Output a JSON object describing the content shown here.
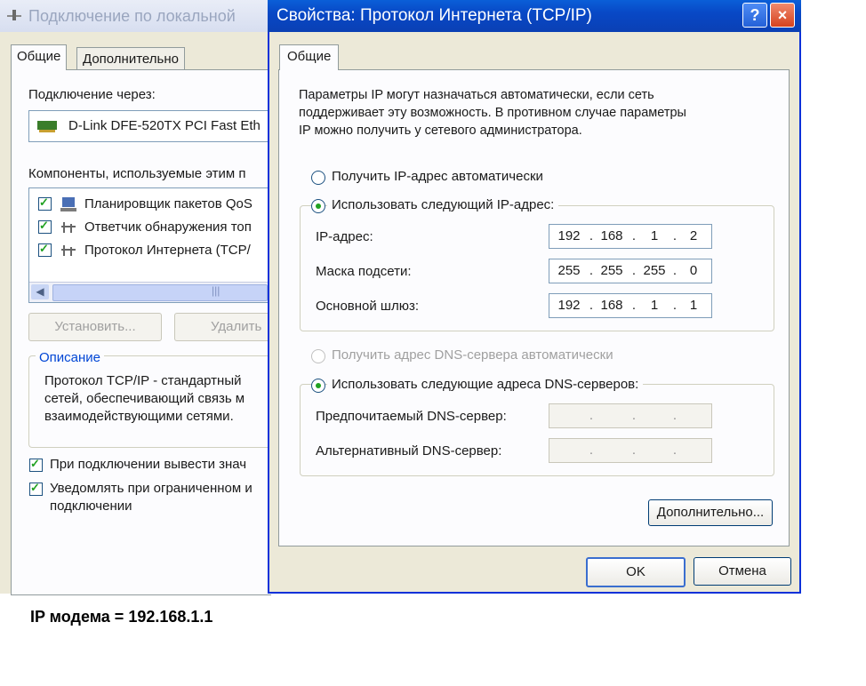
{
  "back_window": {
    "title": "Подключение по локальной",
    "tabs": [
      "Общие",
      "Дополнительно"
    ],
    "connect_via_label": "Подключение через:",
    "adapter_name": "D-Link DFE-520TX PCI Fast Eth",
    "components_label": "Компоненты, используемые этим п",
    "components": [
      {
        "label": "Планировщик пакетов QoS",
        "checked": true,
        "icon": "network-icon"
      },
      {
        "label": "Ответчик обнаружения топ",
        "checked": true,
        "icon": "protocol-icon"
      },
      {
        "label": "Протокол Интернета (TCP/",
        "checked": true,
        "icon": "protocol-icon"
      }
    ],
    "install_button": "Установить...",
    "remove_button": "Удалить",
    "description_label": "Описание",
    "description_text": [
      "Протокол TCP/IP - стандартный",
      "сетей, обеспечивающий связь м",
      "взаимодействующими сетями."
    ],
    "option1": "При подключении вывести знач",
    "option2_line1": "Уведомлять при ограниченном и",
    "option2_line2": "подключении"
  },
  "dialog": {
    "title": "Свойства: Протокол Интернета (TCP/IP)",
    "help_glyph": "?",
    "close_glyph": "×",
    "tab": "Общие",
    "intro": [
      "Параметры IP могут назначаться автоматически, если сеть",
      "поддерживает эту возможность. В противном случае параметры",
      "IP можно получить у сетевого администратора."
    ],
    "radio_auto_ip": "Получить IP-адрес автоматически",
    "radio_manual_ip": "Использовать следующий IP-адрес:",
    "ip_label": "IP-адрес:",
    "ip_value": [
      "192",
      "168",
      "1",
      "2"
    ],
    "mask_label": "Маска подсети:",
    "mask_value": [
      "255",
      "255",
      "255",
      "0"
    ],
    "gateway_label": "Основной шлюз:",
    "gateway_value": [
      "192",
      "168",
      "1",
      "1"
    ],
    "radio_auto_dns": "Получить адрес DNS-сервера автоматически",
    "radio_manual_dns": "Использовать следующие адреса DNS-серверов:",
    "preferred_dns_label": "Предпочитаемый DNS-сервер:",
    "alternate_dns_label": "Альтернативный DNS-сервер:",
    "advanced_button": "Дополнительно...",
    "ok_button": "OK",
    "cancel_button": "Отмена"
  },
  "note": "IP модема = 192.168.1.1"
}
